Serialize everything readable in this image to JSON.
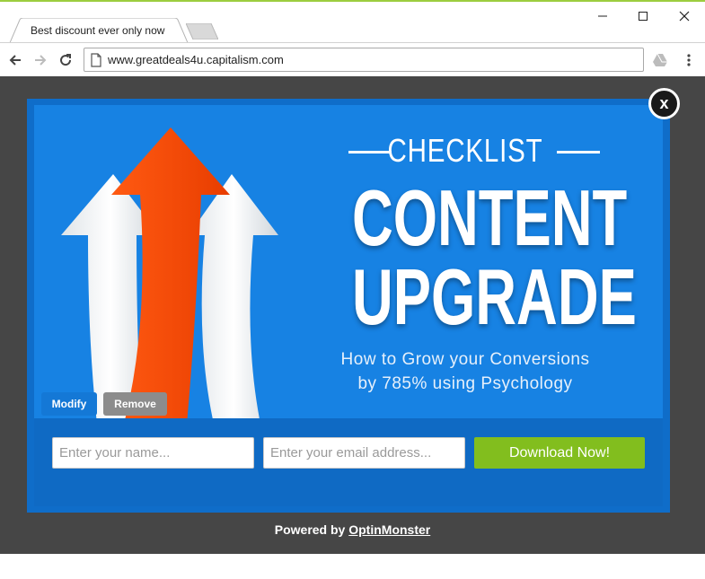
{
  "browser": {
    "tab_title": "Best discount ever only now",
    "url": "www.greatdeals4u.capitalism.com"
  },
  "popup": {
    "close_label": "x",
    "eyebrow": "CHECKLIST",
    "headline_line1": "CONTENT",
    "headline_line2": "UPGRADE",
    "subtitle_line1": "How to Grow your Conversions",
    "subtitle_line2": "by 785% using Psychology",
    "modify_label": "Modify",
    "remove_label": "Remove",
    "name_placeholder": "Enter your name...",
    "email_placeholder": "Enter your email address...",
    "download_label": "Download Now!",
    "powered_prefix": "Powered by",
    "powered_link": "OptinMonster"
  },
  "colors": {
    "popup_blue": "#1782e3",
    "download_green": "#82be1e",
    "arrow_orange": "#ff4a0a",
    "overlay": "#464646"
  }
}
